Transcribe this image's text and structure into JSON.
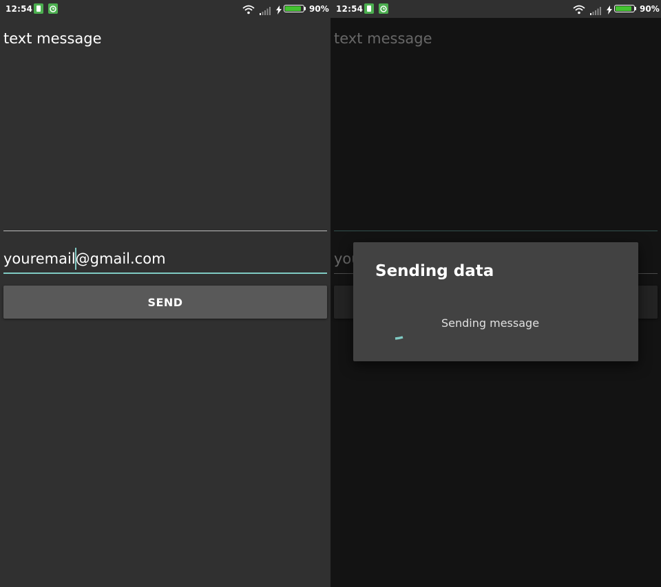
{
  "colors": {
    "background": "#303030",
    "accent": "#80cbc4",
    "button": "#595959",
    "dialog": "#424242",
    "battery": "#43c330",
    "notification": "#4caf50"
  },
  "status_bar": {
    "time": "12:54",
    "battery": "90%",
    "battery_level": 0.9,
    "icons": [
      "sim-card-icon",
      "alarm-app-icon",
      "wifi-icon",
      "signal-icon",
      "charging-icon",
      "battery-icon"
    ]
  },
  "screen": {
    "message_field": {
      "value": "text message"
    },
    "email_field": {
      "value": "youremail@gmail.com"
    },
    "send_button": {
      "label": "SEND"
    }
  },
  "dialog": {
    "title": "Sending data",
    "message": "Sending message"
  }
}
